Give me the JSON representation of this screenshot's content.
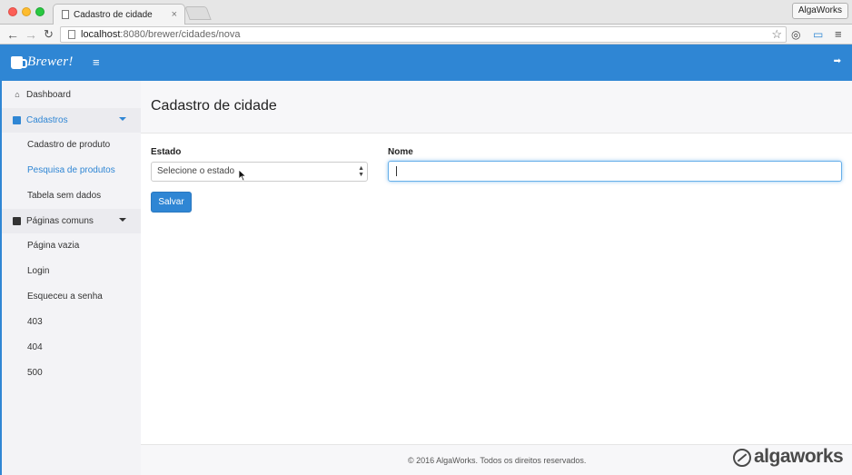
{
  "browser": {
    "tab_title": "Cadastro de cidade",
    "tab_close": "×",
    "profile": "AlgaWorks",
    "url_host": "localhost",
    "url_path": ":8080/brewer/cidades/nova"
  },
  "header": {
    "brand": "Brewer!",
    "hamburger": "≡",
    "logout": "➡"
  },
  "sidebar": {
    "items": [
      {
        "label": "Dashboard",
        "icon": "home-icon",
        "glyph": "⌂"
      },
      {
        "label": "Cadastros",
        "icon": "folder-icon"
      },
      {
        "label": "Cadastro de produto"
      },
      {
        "label": "Pesquisa de produtos"
      },
      {
        "label": "Tabela sem dados"
      },
      {
        "label": "Páginas comuns",
        "icon": "file-icon"
      },
      {
        "label": "Página vazia"
      },
      {
        "label": "Login"
      },
      {
        "label": "Esqueceu a senha"
      },
      {
        "label": "403"
      },
      {
        "label": "404"
      },
      {
        "label": "500"
      }
    ]
  },
  "main": {
    "title": "Cadastro de cidade",
    "form": {
      "estado_label": "Estado",
      "estado_value": "Selecione o estado",
      "nome_label": "Nome",
      "nome_value": "",
      "save_label": "Salvar"
    }
  },
  "footer": {
    "text": "© 2016 AlgaWorks. Todos os direitos reservados."
  },
  "watermark": {
    "text": "algaworks"
  },
  "colors": {
    "primary": "#2f86d4",
    "sidebar_bg": "#f3f3f6",
    "page_head_bg": "#f7f7f9"
  }
}
